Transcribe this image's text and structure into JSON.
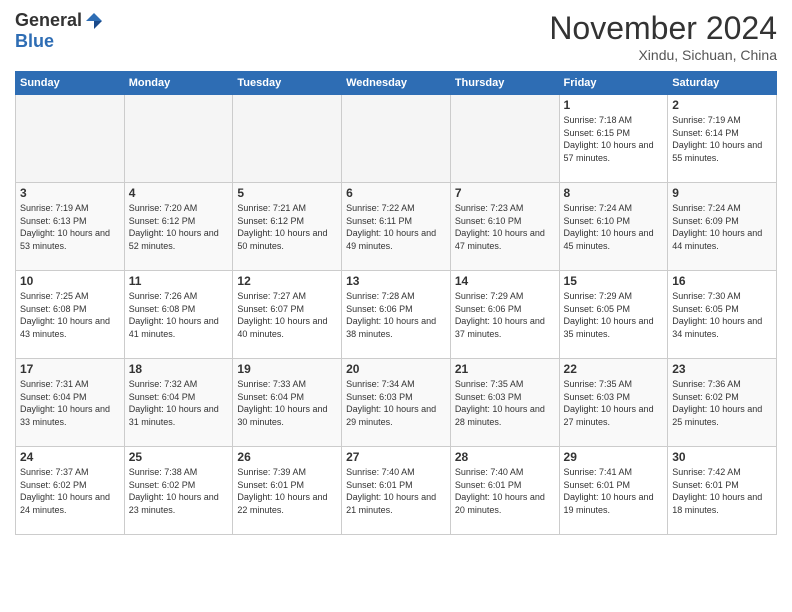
{
  "header": {
    "logo_general": "General",
    "logo_blue": "Blue",
    "title": "November 2024",
    "subtitle": "Xindu, Sichuan, China"
  },
  "weekdays": [
    "Sunday",
    "Monday",
    "Tuesday",
    "Wednesday",
    "Thursday",
    "Friday",
    "Saturday"
  ],
  "weeks": [
    [
      {
        "day": "",
        "empty": true
      },
      {
        "day": "",
        "empty": true
      },
      {
        "day": "",
        "empty": true
      },
      {
        "day": "",
        "empty": true
      },
      {
        "day": "",
        "empty": true
      },
      {
        "day": "1",
        "info": "Sunrise: 7:18 AM\nSunset: 6:15 PM\nDaylight: 10 hours and 57 minutes."
      },
      {
        "day": "2",
        "info": "Sunrise: 7:19 AM\nSunset: 6:14 PM\nDaylight: 10 hours and 55 minutes."
      }
    ],
    [
      {
        "day": "3",
        "info": "Sunrise: 7:19 AM\nSunset: 6:13 PM\nDaylight: 10 hours and 53 minutes."
      },
      {
        "day": "4",
        "info": "Sunrise: 7:20 AM\nSunset: 6:12 PM\nDaylight: 10 hours and 52 minutes."
      },
      {
        "day": "5",
        "info": "Sunrise: 7:21 AM\nSunset: 6:12 PM\nDaylight: 10 hours and 50 minutes."
      },
      {
        "day": "6",
        "info": "Sunrise: 7:22 AM\nSunset: 6:11 PM\nDaylight: 10 hours and 49 minutes."
      },
      {
        "day": "7",
        "info": "Sunrise: 7:23 AM\nSunset: 6:10 PM\nDaylight: 10 hours and 47 minutes."
      },
      {
        "day": "8",
        "info": "Sunrise: 7:24 AM\nSunset: 6:10 PM\nDaylight: 10 hours and 45 minutes."
      },
      {
        "day": "9",
        "info": "Sunrise: 7:24 AM\nSunset: 6:09 PM\nDaylight: 10 hours and 44 minutes."
      }
    ],
    [
      {
        "day": "10",
        "info": "Sunrise: 7:25 AM\nSunset: 6:08 PM\nDaylight: 10 hours and 43 minutes."
      },
      {
        "day": "11",
        "info": "Sunrise: 7:26 AM\nSunset: 6:08 PM\nDaylight: 10 hours and 41 minutes."
      },
      {
        "day": "12",
        "info": "Sunrise: 7:27 AM\nSunset: 6:07 PM\nDaylight: 10 hours and 40 minutes."
      },
      {
        "day": "13",
        "info": "Sunrise: 7:28 AM\nSunset: 6:06 PM\nDaylight: 10 hours and 38 minutes."
      },
      {
        "day": "14",
        "info": "Sunrise: 7:29 AM\nSunset: 6:06 PM\nDaylight: 10 hours and 37 minutes."
      },
      {
        "day": "15",
        "info": "Sunrise: 7:29 AM\nSunset: 6:05 PM\nDaylight: 10 hours and 35 minutes."
      },
      {
        "day": "16",
        "info": "Sunrise: 7:30 AM\nSunset: 6:05 PM\nDaylight: 10 hours and 34 minutes."
      }
    ],
    [
      {
        "day": "17",
        "info": "Sunrise: 7:31 AM\nSunset: 6:04 PM\nDaylight: 10 hours and 33 minutes."
      },
      {
        "day": "18",
        "info": "Sunrise: 7:32 AM\nSunset: 6:04 PM\nDaylight: 10 hours and 31 minutes."
      },
      {
        "day": "19",
        "info": "Sunrise: 7:33 AM\nSunset: 6:04 PM\nDaylight: 10 hours and 30 minutes."
      },
      {
        "day": "20",
        "info": "Sunrise: 7:34 AM\nSunset: 6:03 PM\nDaylight: 10 hours and 29 minutes."
      },
      {
        "day": "21",
        "info": "Sunrise: 7:35 AM\nSunset: 6:03 PM\nDaylight: 10 hours and 28 minutes."
      },
      {
        "day": "22",
        "info": "Sunrise: 7:35 AM\nSunset: 6:03 PM\nDaylight: 10 hours and 27 minutes."
      },
      {
        "day": "23",
        "info": "Sunrise: 7:36 AM\nSunset: 6:02 PM\nDaylight: 10 hours and 25 minutes."
      }
    ],
    [
      {
        "day": "24",
        "info": "Sunrise: 7:37 AM\nSunset: 6:02 PM\nDaylight: 10 hours and 24 minutes."
      },
      {
        "day": "25",
        "info": "Sunrise: 7:38 AM\nSunset: 6:02 PM\nDaylight: 10 hours and 23 minutes."
      },
      {
        "day": "26",
        "info": "Sunrise: 7:39 AM\nSunset: 6:01 PM\nDaylight: 10 hours and 22 minutes."
      },
      {
        "day": "27",
        "info": "Sunrise: 7:40 AM\nSunset: 6:01 PM\nDaylight: 10 hours and 21 minutes."
      },
      {
        "day": "28",
        "info": "Sunrise: 7:40 AM\nSunset: 6:01 PM\nDaylight: 10 hours and 20 minutes."
      },
      {
        "day": "29",
        "info": "Sunrise: 7:41 AM\nSunset: 6:01 PM\nDaylight: 10 hours and 19 minutes."
      },
      {
        "day": "30",
        "info": "Sunrise: 7:42 AM\nSunset: 6:01 PM\nDaylight: 10 hours and 18 minutes."
      }
    ]
  ]
}
